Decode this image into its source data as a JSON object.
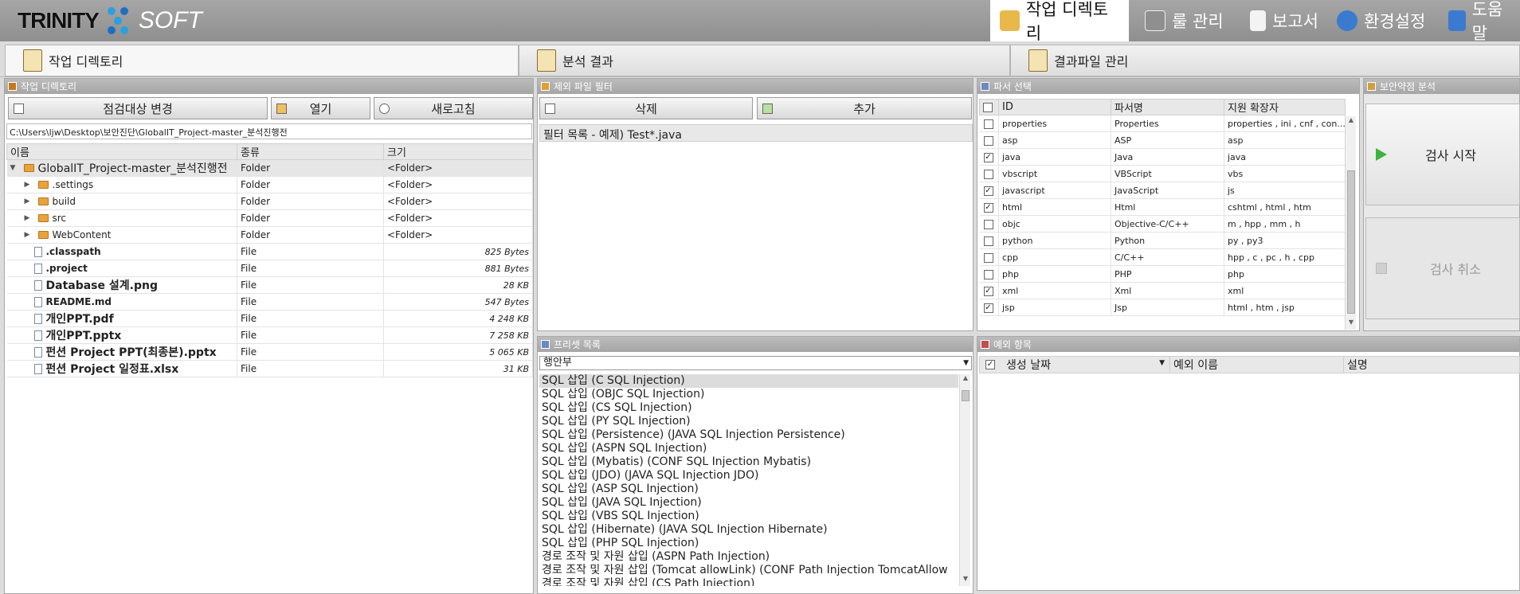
{
  "app": {
    "logo_left": "TRINITY",
    "logo_right": "SOFT"
  },
  "topmenu": [
    {
      "label": "작업 디렉토리",
      "icon": "folder-gear-icon"
    },
    {
      "label": "룰 관리",
      "icon": "folder-rules-icon"
    },
    {
      "label": "보고서",
      "icon": "report-icon"
    },
    {
      "label": "환경설정",
      "icon": "gear-icon"
    },
    {
      "label": "도움말",
      "icon": "help-icon"
    }
  ],
  "tabs": [
    {
      "label": "작업 디렉토리"
    },
    {
      "label": "분석 결과"
    },
    {
      "label": "결과파일 관리"
    }
  ],
  "workdir": {
    "title": "작업 디렉토리",
    "btn_change": "점검대상 변경",
    "btn_open": "열기",
    "btn_refresh": "새로고침",
    "path": "C:\\Users\\ljw\\Desktop\\보안진단\\GlobalIT_Project-master_분석진행전",
    "columns": [
      "이름",
      "종류",
      "크기"
    ],
    "rows": [
      {
        "name": "GlobalIT_Project-master_분석진행전",
        "type": "Folder",
        "size": "<Folder>",
        "kind": "root"
      },
      {
        "name": ".settings",
        "type": "Folder",
        "size": "<Folder>",
        "kind": "folder"
      },
      {
        "name": "build",
        "type": "Folder",
        "size": "<Folder>",
        "kind": "folder"
      },
      {
        "name": "src",
        "type": "Folder",
        "size": "<Folder>",
        "kind": "folder"
      },
      {
        "name": "WebContent",
        "type": "Folder",
        "size": "<Folder>",
        "kind": "folder"
      },
      {
        "name": ".classpath",
        "type": "File",
        "size": "825 Bytes",
        "kind": "file"
      },
      {
        "name": ".project",
        "type": "File",
        "size": "881 Bytes",
        "kind": "file"
      },
      {
        "name": "Database 설계.png",
        "type": "File",
        "size": "28 KB",
        "kind": "file"
      },
      {
        "name": "README.md",
        "type": "File",
        "size": "547 Bytes",
        "kind": "file"
      },
      {
        "name": "개인PPT.pdf",
        "type": "File",
        "size": "4 248 KB",
        "kind": "file"
      },
      {
        "name": "개인PPT.pptx",
        "type": "File",
        "size": "7 258 KB",
        "kind": "file"
      },
      {
        "name": "펀션 Project PPT(최종본).pptx",
        "type": "File",
        "size": "5 065 KB",
        "kind": "file"
      },
      {
        "name": "펀션 Project 일정표.xlsx",
        "type": "File",
        "size": "31 KB",
        "kind": "file"
      }
    ]
  },
  "exclude": {
    "title": "제외 파일 필터",
    "btn_delete": "삭제",
    "btn_add": "추가",
    "header": "필터 목록  - 예제) Test*.java"
  },
  "parser": {
    "title": "파서 선택",
    "columns": [
      "ID",
      "파서명",
      "지원 확장자"
    ],
    "rows": [
      {
        "id": "properties",
        "name": "Properties",
        "ext": "properties , ini , cnf , con...",
        "checked": false
      },
      {
        "id": "asp",
        "name": "ASP",
        "ext": "asp",
        "checked": false
      },
      {
        "id": "java",
        "name": "Java",
        "ext": "java",
        "checked": true
      },
      {
        "id": "vbscript",
        "name": "VBScript",
        "ext": "vbs",
        "checked": false
      },
      {
        "id": "javascript",
        "name": "JavaScript",
        "ext": "js",
        "checked": true
      },
      {
        "id": "html",
        "name": "Html",
        "ext": "cshtml , html , htm",
        "checked": true
      },
      {
        "id": "objc",
        "name": "Objective-C/C++",
        "ext": "m , hpp , mm , h",
        "checked": false
      },
      {
        "id": "python",
        "name": "Python",
        "ext": "py , py3",
        "checked": false
      },
      {
        "id": "cpp",
        "name": "C/C++",
        "ext": "hpp , c , pc , h , cpp",
        "checked": false
      },
      {
        "id": "php",
        "name": "PHP",
        "ext": "php",
        "checked": false
      },
      {
        "id": "xml",
        "name": "Xml",
        "ext": "xml",
        "checked": true
      },
      {
        "id": "jsp",
        "name": "Jsp",
        "ext": "html , htm , jsp",
        "checked": true
      }
    ]
  },
  "vuln": {
    "title": "보안약점 분석",
    "btn_start": "검사 시작",
    "btn_cancel": "검사 취소"
  },
  "preset": {
    "title": "프리셋 목록",
    "selected": "행안부",
    "items": [
      "SQL 삽입 (C SQL Injection)",
      "SQL 삽입 (OBJC SQL Injection)",
      "SQL 삽입 (CS SQL Injection)",
      "SQL 삽입 (PY SQL Injection)",
      "SQL 삽입 (Persistence) (JAVA SQL Injection Persistence)",
      "SQL 삽입 (ASPN SQL Injection)",
      "SQL 삽입 (Mybatis) (CONF SQL Injection Mybatis)",
      "SQL 삽입 (JDO) (JAVA SQL Injection JDO)",
      "SQL 삽입 (ASP SQL Injection)",
      "SQL 삽입 (JAVA SQL Injection)",
      "SQL 삽입 (VBS SQL Injection)",
      "SQL 삽입 (Hibernate) (JAVA SQL Injection Hibernate)",
      "SQL 삽입 (PHP SQL Injection)",
      "경로 조작 및 자원 삽입 (ASPN Path Injection)",
      "경로 조작 및 자원 삽입 (Tomcat allowLink) (CONF Path Injection TomcatAllow",
      "경로 조작 및 자원 삽입 (CS Path Injection)"
    ]
  },
  "exceptions": {
    "title": "예외 항목",
    "columns": [
      "생성 날짜",
      "예외 이름",
      "설명"
    ]
  }
}
